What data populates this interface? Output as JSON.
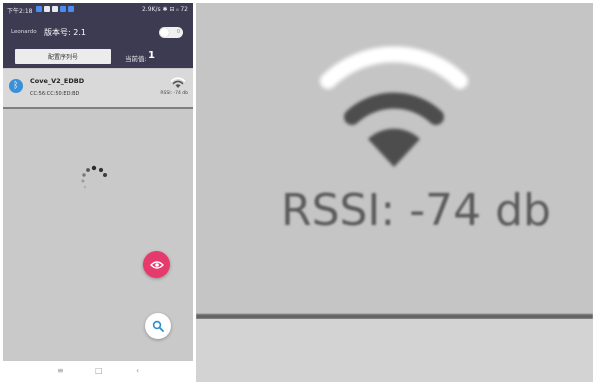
{
  "status_bar": {
    "time": "下午2:18",
    "network": "2.9K/s",
    "right_icons": "✱ ⊟ ᵢₗ 72"
  },
  "header": {
    "app_name": "Leonardo",
    "version": "版本号: 2.1",
    "toggle_label": "0",
    "config_button": "配置序列号",
    "current_value_label": "当前值:",
    "current_value": "1"
  },
  "device": {
    "name": "Cove_V2_EDBD",
    "mac": "CC:56:CC:50:ED:BD",
    "rssi": "RSSI: -74 db",
    "bluetooth_icon": "bluetooth-icon",
    "signal_icon": "wifi-signal-icon"
  },
  "fabs": {
    "eye_icon": "eye-icon",
    "search_icon": "search-icon"
  },
  "navbar": {
    "menu": "≡",
    "home": "□",
    "back": "‹"
  },
  "zoom": {
    "rssi": "RSSI: -74 db"
  },
  "colors": {
    "header_bg": "#3d3b52",
    "bluetooth": "#3b8fd6",
    "fab_eye": "#e63a6c",
    "fab_search_icon": "#2a8fd0"
  }
}
